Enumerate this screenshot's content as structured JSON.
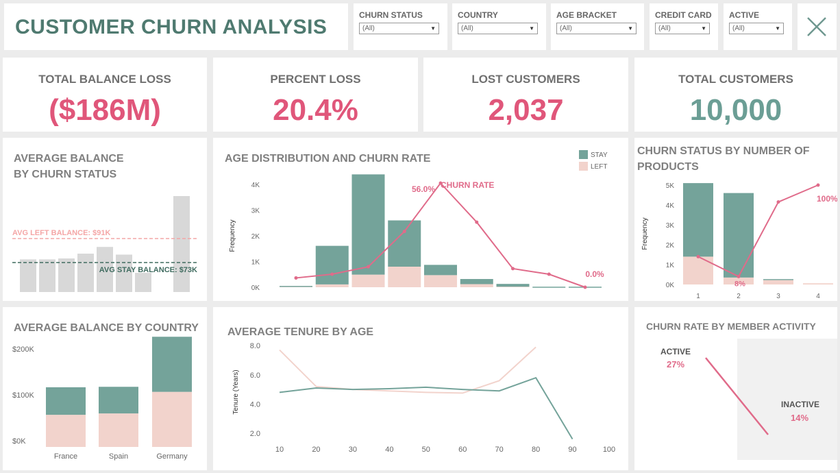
{
  "header": {
    "title": "CUSTOMER CHURN ANALYSIS",
    "close_icon": "close-icon"
  },
  "filters": [
    {
      "label": "CHURN STATUS",
      "value": "(All)"
    },
    {
      "label": "COUNTRY",
      "value": "(All)"
    },
    {
      "label": "AGE BRACKET",
      "value": "(All)"
    },
    {
      "label": "CREDIT CARD",
      "value": "(All)"
    },
    {
      "label": "ACTIVE",
      "value": "(All)"
    }
  ],
  "kpis": [
    {
      "label": "TOTAL BALANCE LOSS",
      "value": "($186M)",
      "color": "#e0567a"
    },
    {
      "label": "PERCENT LOSS",
      "value": "20.4%",
      "color": "#e0567a"
    },
    {
      "label": "LOST CUSTOMERS",
      "value": "2,037",
      "color": "#e0567a"
    },
    {
      "label": "TOTAL CUSTOMERS",
      "value": "10,000",
      "color": "#6b9e95"
    }
  ],
  "colors": {
    "stay": "#74a39a",
    "left": "#f2d3cc",
    "churn_line": "#e06b8a",
    "gray_bar": "#d8d8d8",
    "left_ref": "#f4a6a6",
    "stay_ref": "#3f6b5f"
  },
  "titles": {
    "avg_balance_line1": "AVERAGE BALANCE",
    "avg_balance_line2": "BY CHURN STATUS",
    "age_dist": "AGE DISTRIBUTION AND CHURN RATE",
    "products_line1": "CHURN STATUS BY NUMBER OF",
    "products_line2": "PRODUCTS",
    "country": "AVERAGE BALANCE BY COUNTRY",
    "tenure": "AVERAGE TENURE BY AGE",
    "activity": "CHURN RATE BY MEMBER ACTIVITY"
  },
  "chart_data": [
    {
      "id": "avg_balance_by_churn",
      "type": "bar",
      "values": [
        0.34,
        0.34,
        0.35,
        0.4,
        0.47,
        0.39,
        0.2,
        1.0
      ],
      "reference_lines": [
        {
          "label": "AVG LEFT BALANCE: $91K",
          "value": 91
        },
        {
          "label": "AVG STAY BALANCE: $73K",
          "value": 73
        }
      ]
    },
    {
      "id": "age_distribution",
      "type": "bar",
      "ylabel": "Frequency",
      "y_ticks": [
        "0K",
        "1K",
        "2K",
        "3K",
        "4K"
      ],
      "ylim": [
        0,
        4300
      ],
      "legend": [
        "STAY",
        "LEFT"
      ],
      "bins": 9,
      "stay": [
        40,
        1500,
        3900,
        1800,
        400,
        200,
        110,
        20,
        20
      ],
      "left": [
        10,
        110,
        490,
        800,
        470,
        120,
        20,
        0,
        0
      ],
      "churn_rate_label": "CHURN RATE",
      "churn_rate": [
        5,
        7,
        11,
        30,
        56,
        35,
        10,
        7,
        0
      ],
      "annotations": [
        {
          "text": "56.0%",
          "index": 4
        },
        {
          "text": "0.0%",
          "index": 8
        }
      ]
    },
    {
      "id": "products",
      "type": "bar",
      "ylabel": "Frequency",
      "categories": [
        "1",
        "2",
        "3",
        "4"
      ],
      "y_ticks": [
        "0K",
        "1K",
        "2K",
        "3K",
        "4K",
        "5K"
      ],
      "ylim": [
        0,
        5200
      ],
      "stay": [
        3700,
        4250,
        50,
        0
      ],
      "left": [
        1400,
        350,
        220,
        60
      ],
      "churn_rate": [
        28,
        8,
        83,
        100
      ],
      "annotations": [
        {
          "text": "8%",
          "index": 1
        },
        {
          "text": "100%",
          "index": 3
        }
      ]
    },
    {
      "id": "country",
      "type": "bar",
      "categories": [
        "France",
        "Spain",
        "Germany"
      ],
      "y_ticks": [
        "$0K",
        "$100K",
        "$200K"
      ],
      "ylim": [
        0,
        215
      ],
      "left": [
        70,
        73,
        120
      ],
      "stay": [
        60,
        58,
        120
      ]
    },
    {
      "id": "tenure",
      "type": "line",
      "ylabel": "Tenure (Years)",
      "x_ticks": [
        "10",
        "20",
        "30",
        "40",
        "50",
        "60",
        "70",
        "80",
        "90",
        "100"
      ],
      "y_ticks": [
        "2.0",
        "4.0",
        "6.0",
        "8.0"
      ],
      "ylim": [
        1.5,
        8.5
      ],
      "xlim": [
        10,
        100
      ],
      "stay": [
        [
          10,
          4.8
        ],
        [
          20,
          5.1
        ],
        [
          30,
          5.0
        ],
        [
          40,
          5.05
        ],
        [
          50,
          5.15
        ],
        [
          60,
          5.0
        ],
        [
          70,
          4.9
        ],
        [
          80,
          5.8
        ],
        [
          90,
          1.6
        ]
      ],
      "left": [
        [
          10,
          7.7
        ],
        [
          20,
          5.2
        ],
        [
          30,
          5.0
        ],
        [
          40,
          4.9
        ],
        [
          50,
          4.8
        ],
        [
          60,
          4.75
        ],
        [
          70,
          5.6
        ],
        [
          80,
          7.9
        ]
      ]
    },
    {
      "id": "activity",
      "type": "line",
      "categories": [
        "ACTIVE",
        "INACTIVE"
      ],
      "values": [
        27,
        14
      ],
      "labels": [
        "27%",
        "14%"
      ]
    }
  ]
}
